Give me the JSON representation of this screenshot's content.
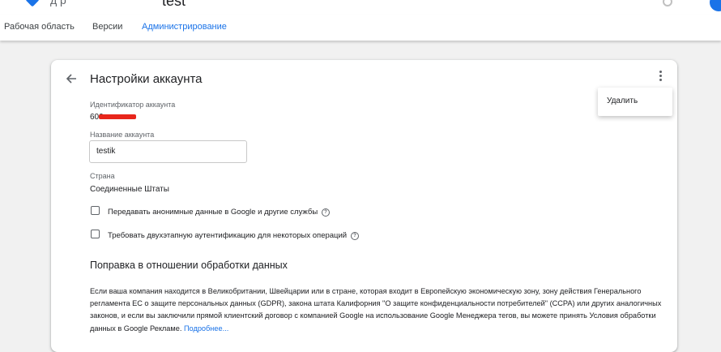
{
  "header": {
    "container_name": "test",
    "title_fragment": "д              р"
  },
  "nav": {
    "tabs": [
      {
        "label": "Рабочая область"
      },
      {
        "label": "Версии"
      },
      {
        "label": "Администрирование",
        "active": true
      }
    ]
  },
  "page": {
    "title": "Настройки аккаунта"
  },
  "menu": {
    "delete_label": "Удалить"
  },
  "account": {
    "id_label": "Идентификатор аккаунта",
    "id_prefix": "600",
    "name_label": "Название аккаунта",
    "name_value": "testik",
    "country_label": "Страна",
    "country_value": "Соединенные Штаты"
  },
  "options": [
    {
      "label": "Передавать анонимные данные в Google и другие службы",
      "checked": false
    },
    {
      "label": "Требовать двухэтапную аутентификацию для некоторых операций",
      "checked": false
    }
  ],
  "data_processing": {
    "title": "Поправка в отношении обработки данных",
    "text": "Если ваша компания находится в Великобритании, Швейцарии или в стране, которая входит в Европейскую экономическую зону, зону действия Генерального регламента ЕС о защите персональных данных (GDPR), закона штата Калифорния \"О защите конфиденциальности потребителей\" (CCPA) или других аналогичных законов, и если вы заключили прямой клиентский договор с компанией Google на использование Google Менеджера тегов, вы можете принять Условия обработки данных в Google Рекламе.",
    "link": "Подробнее..."
  },
  "colors": {
    "accent": "#1a73e8",
    "redaction": "#e8261b"
  },
  "icons": [
    "back-arrow-icon",
    "more-vert-icon",
    "help-icon",
    "checkbox"
  ]
}
